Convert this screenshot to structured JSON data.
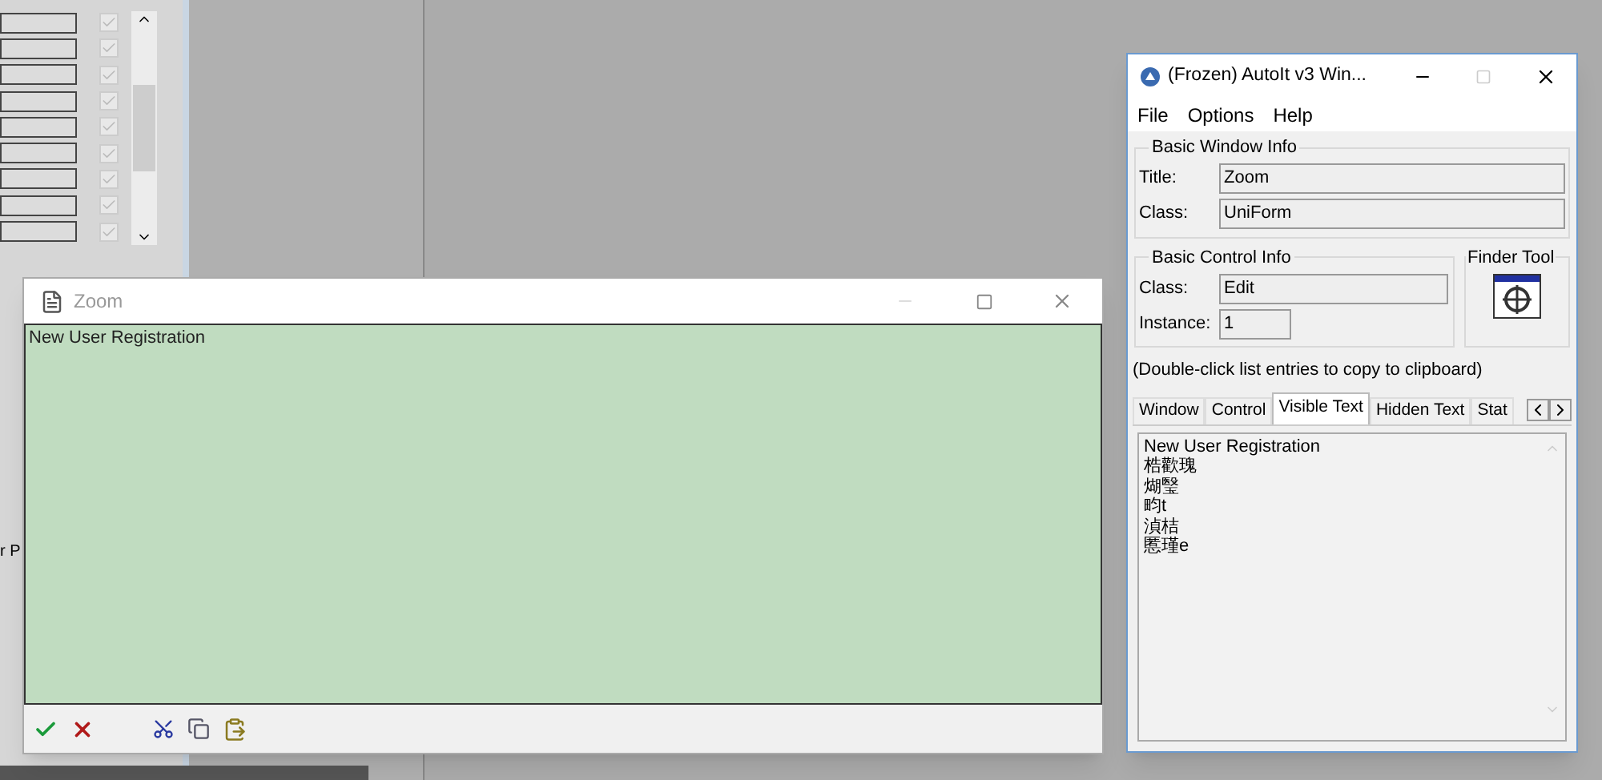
{
  "background_app": {
    "rows": [
      {
        "checked": true
      },
      {
        "checked": true
      },
      {
        "checked": true
      },
      {
        "checked": true
      },
      {
        "checked": true
      },
      {
        "checked": true
      },
      {
        "checked": true
      },
      {
        "checked": true
      },
      {
        "checked": true
      }
    ],
    "partial_label": "r P"
  },
  "zoom_window": {
    "title": "Zoom",
    "text": "New User Registration"
  },
  "autoit_window": {
    "title": "(Frozen) AutoIt v3 Win...",
    "menu": [
      "File",
      "Options",
      "Help"
    ],
    "window_info": {
      "heading": "Basic Window Info",
      "fields": [
        {
          "label": "Title:",
          "value": "Zoom"
        },
        {
          "label": "Class:",
          "value": "UniForm"
        }
      ]
    },
    "control_info": {
      "heading": "Basic Control Info",
      "fields": [
        {
          "label": "Class:",
          "value": "Edit"
        },
        {
          "label": "Instance:",
          "value": "1"
        }
      ]
    },
    "finder_tool": {
      "heading": "Finder Tool"
    },
    "hint": "(Double-click list entries to copy to clipboard)",
    "tabs": [
      {
        "label": "Window",
        "selected": false
      },
      {
        "label": "Control",
        "selected": false
      },
      {
        "label": "Visible Text",
        "selected": true
      },
      {
        "label": "Hidden Text",
        "selected": false
      },
      {
        "label": "Stat",
        "selected": false
      }
    ],
    "list_lines": [
      "New User Registration",
      "梏歡瑰",
      "煳瑿",
      "畇t",
      "湞桔",
      "慝瑾e"
    ]
  }
}
